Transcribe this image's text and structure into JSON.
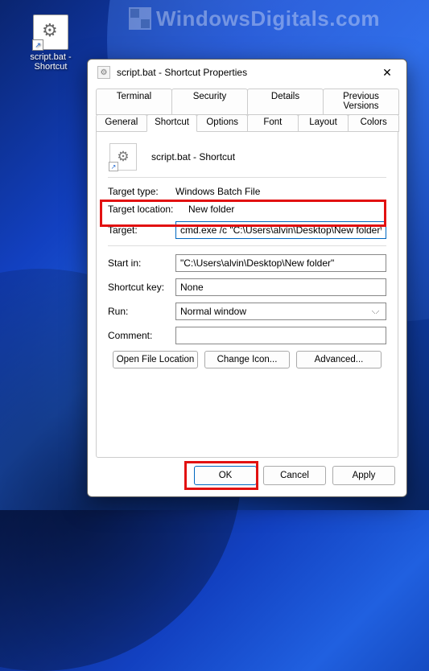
{
  "watermark": "WindowsDigitals.com",
  "desktop": {
    "icon_label": "script.bat - Shortcut"
  },
  "dialog": {
    "title": "script.bat - Shortcut Properties",
    "tabs_back": [
      "Terminal",
      "Security",
      "Details",
      "Previous Versions"
    ],
    "tabs_front": [
      "General",
      "Shortcut",
      "Options",
      "Font",
      "Layout",
      "Colors"
    ],
    "active_tab": "Shortcut",
    "shortcut_name": "script.bat - Shortcut",
    "labels": {
      "target_type": "Target type:",
      "target_location": "Target location:",
      "target": "Target:",
      "start_in": "Start in:",
      "shortcut_key": "Shortcut key:",
      "run": "Run:",
      "comment": "Comment:"
    },
    "values": {
      "target_type": "Windows Batch File",
      "target_location": "New folder",
      "target": "cmd.exe /c \"C:\\Users\\alvin\\Desktop\\New folder\\",
      "start_in": "\"C:\\Users\\alvin\\Desktop\\New folder\"",
      "shortcut_key": "None",
      "run": "Normal window",
      "comment": ""
    },
    "buttons": {
      "open_location": "Open File Location",
      "change_icon": "Change Icon...",
      "advanced": "Advanced..."
    },
    "footer": {
      "ok": "OK",
      "cancel": "Cancel",
      "apply": "Apply"
    }
  }
}
